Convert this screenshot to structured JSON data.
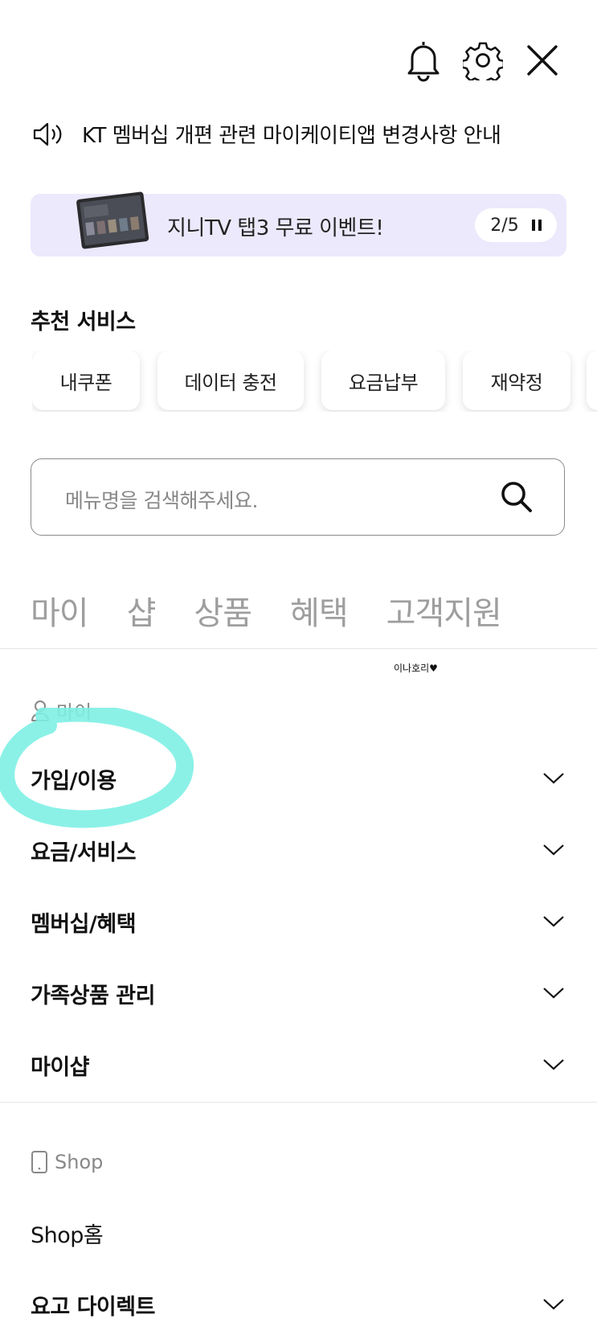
{
  "header": {
    "icons": [
      "bell-icon",
      "gear-icon",
      "close-icon"
    ]
  },
  "notice": {
    "text": "KT 멤버십 개편 관련 마이케이티앱 변경사항 안내",
    "icon": "speaker-icon"
  },
  "banner": {
    "text": "지니TV 탭3 무료 이벤트!",
    "counter": "2/5",
    "background": "#ece9fc"
  },
  "recommended": {
    "title": "추천 서비스",
    "chips": [
      "내쿠폰",
      "데이터 충전",
      "요금납부",
      "재약정"
    ]
  },
  "search": {
    "placeholder": "메뉴명을 검색해주세요."
  },
  "tabs": [
    "마이",
    "샵",
    "상품",
    "혜택",
    "고객지원"
  ],
  "watermark": "이나호리♥",
  "my_section": {
    "label": "마이",
    "items": [
      "가입/이용",
      "요금/서비스",
      "멤버십/혜택",
      "가족상품 관리",
      "마이샵"
    ]
  },
  "shop_section": {
    "label": "Shop",
    "items": [
      "Shop홈",
      "요고 다이렉트"
    ]
  },
  "colors": {
    "highlight": "#7ef0e4",
    "tab_inactive": "#9e9e9e"
  }
}
